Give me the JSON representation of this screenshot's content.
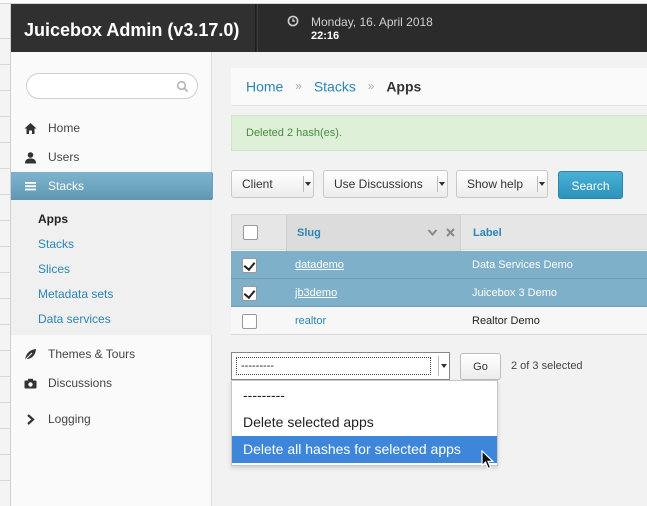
{
  "header": {
    "title": "Juicebox Admin (v3.17.0)",
    "date": "Monday, 16. April 2018",
    "time": "22:16"
  },
  "sidebar": {
    "search_placeholder": "",
    "items": [
      {
        "label": "Home",
        "icon": "home-icon"
      },
      {
        "label": "Users",
        "icon": "user-icon"
      },
      {
        "label": "Stacks",
        "icon": "list-icon",
        "active": true
      },
      {
        "label": "Themes & Tours",
        "icon": "leaf-icon"
      },
      {
        "label": "Discussions",
        "icon": "camera-icon"
      },
      {
        "label": "Logging",
        "icon": "chevron-right-icon"
      }
    ],
    "subitems": [
      "Apps",
      "Stacks",
      "Slices",
      "Metadata sets",
      "Data services"
    ],
    "current_subitem": "Apps"
  },
  "breadcrumb": [
    "Home",
    "Stacks",
    "Apps"
  ],
  "breadcrumb_sep": "»",
  "alert": "Deleted 2 hash(es).",
  "filters": {
    "client": "Client",
    "discussions": "Use Discussions",
    "help": "Show help",
    "search_button": "Search"
  },
  "table": {
    "columns": [
      "Slug",
      "Label"
    ],
    "rows": [
      {
        "slug": "datademo",
        "label": "Data Services Demo",
        "checked": true
      },
      {
        "slug": "jb3demo",
        "label": "Juicebox 3 Demo",
        "checked": true
      },
      {
        "slug": "realtor",
        "label": "Realtor Demo",
        "checked": false
      }
    ]
  },
  "actions": {
    "selected_value": "---------",
    "go_button": "Go",
    "selection_count": "2 of 3 selected",
    "options": [
      "---------",
      "Delete selected apps",
      "Delete all hashes for selected apps"
    ],
    "highlighted_option": "Delete all hashes for selected apps"
  },
  "colors": {
    "header_bg": "#2b2b2b",
    "accent": "#2a86b4",
    "active_nav": "#6aa3bd",
    "selected_row": "#7eb0c9",
    "success_bg": "#dff0d8",
    "highlight_option": "#3d86d9"
  }
}
